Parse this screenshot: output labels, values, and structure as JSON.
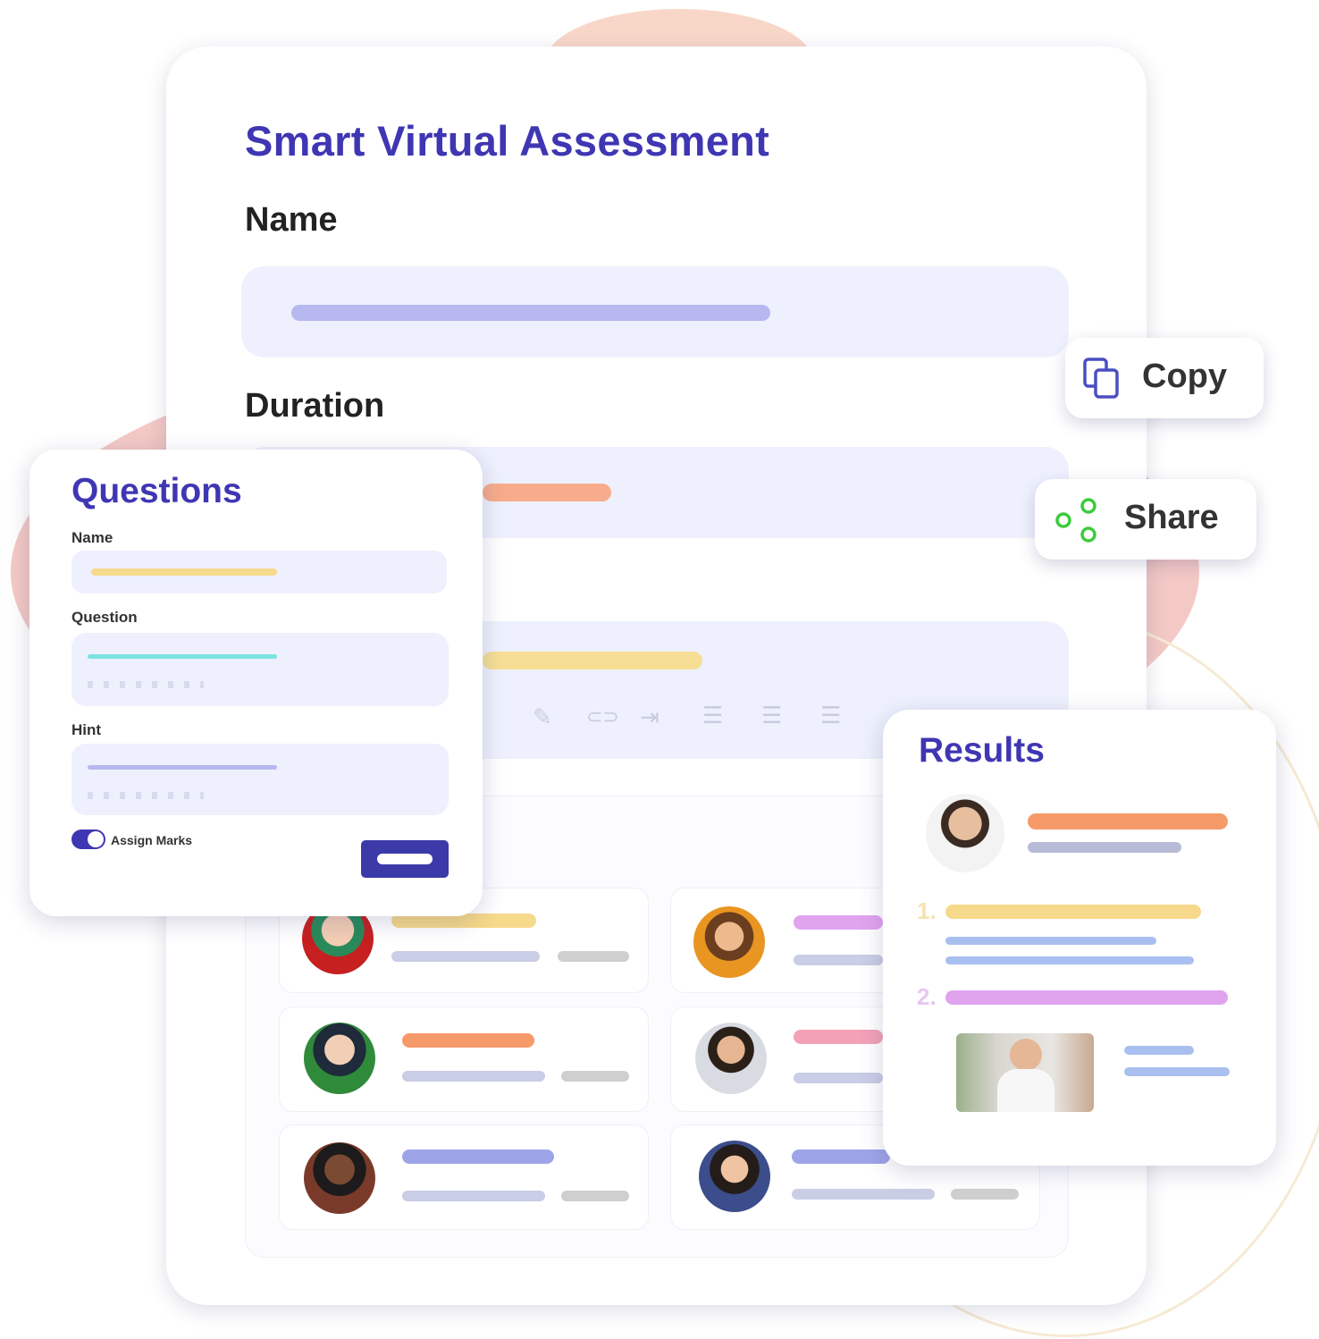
{
  "assessment": {
    "title": "Smart Virtual Assessment",
    "name_label": "Name",
    "duration_label": "Duration"
  },
  "actions": {
    "copy_label": "Copy",
    "copy_icon": "copy-icon",
    "share_label": "Share",
    "share_icon": "share-icon"
  },
  "questions_panel": {
    "title": "Questions",
    "name_label": "Name",
    "question_label": "Question",
    "hint_label": "Hint",
    "toggle_label": "Assign Marks",
    "toggle_on": true
  },
  "results_panel": {
    "title": "Results",
    "list_numbers": [
      "1.",
      "2."
    ]
  },
  "colors": {
    "brand": "#3f36b3",
    "field_bg": "#eef1fd",
    "orange": "#f79a6a",
    "yellow": "#f6d98a",
    "lavender": "#b6b8ef",
    "pink": "#f3a1b7",
    "purple": "#e0a3ee",
    "teal": "#7be3e0",
    "blue": "#a9bff0",
    "share_green": "#3ccb3c"
  }
}
